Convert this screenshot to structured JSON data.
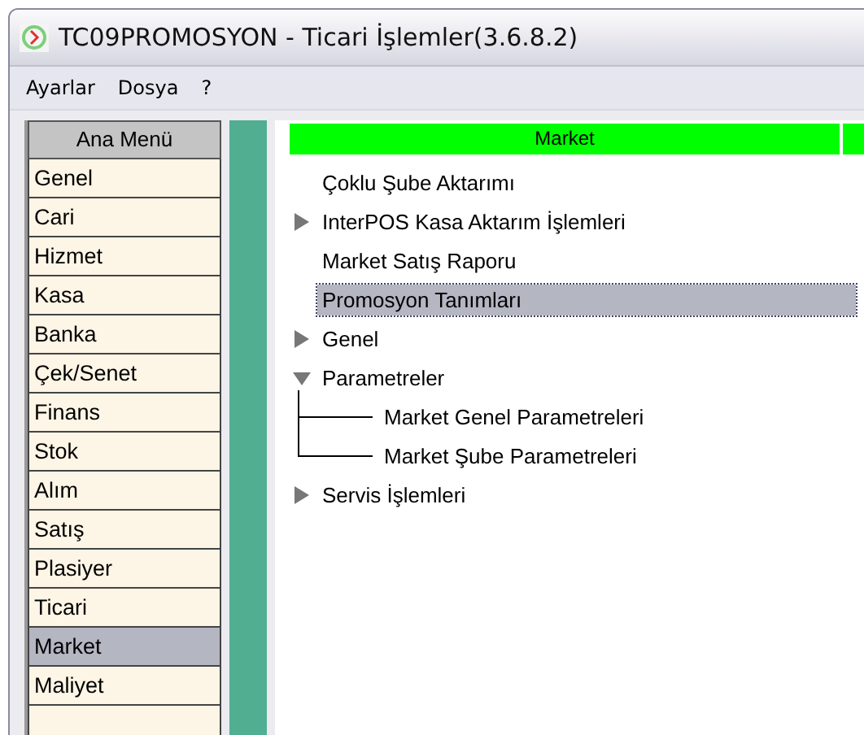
{
  "window": {
    "title": "TC09PROMOSYON - Ticari İşlemler(3.6.8.2)"
  },
  "menu": [
    "Ayarlar",
    "Dosya",
    "?"
  ],
  "sidebar": {
    "header": "Ana Menü",
    "items": [
      {
        "label": "Genel",
        "selected": false
      },
      {
        "label": "Cari",
        "selected": false
      },
      {
        "label": "Hizmet",
        "selected": false
      },
      {
        "label": "Kasa",
        "selected": false
      },
      {
        "label": "Banka",
        "selected": false
      },
      {
        "label": "Çek/Senet",
        "selected": false
      },
      {
        "label": "Finans",
        "selected": false
      },
      {
        "label": "Stok",
        "selected": false
      },
      {
        "label": "Alım",
        "selected": false
      },
      {
        "label": "Satış",
        "selected": false
      },
      {
        "label": "Plasiyer",
        "selected": false
      },
      {
        "label": "Ticari",
        "selected": false
      },
      {
        "label": "Market",
        "selected": true
      },
      {
        "label": "Maliyet",
        "selected": false
      }
    ]
  },
  "panel": {
    "title": "Market",
    "tree": [
      {
        "label": "Çoklu Şube Aktarımı",
        "selected": false
      },
      {
        "label": "InterPOS Kasa Aktarım İşlemleri",
        "selected": false,
        "expanded": false
      },
      {
        "label": "Market Satış Raporu",
        "selected": false
      },
      {
        "label": "Promosyon Tanımları",
        "selected": true
      },
      {
        "label": "Genel",
        "selected": false,
        "expanded": false
      },
      {
        "label": "Parametreler",
        "selected": false,
        "expanded": true,
        "children": [
          {
            "label": "Market Genel Parametreleri",
            "selected": false
          },
          {
            "label": "Market Şube Parametreleri",
            "selected": false
          }
        ]
      },
      {
        "label": "Servis İşlemleri",
        "selected": false,
        "expanded": false
      }
    ]
  }
}
